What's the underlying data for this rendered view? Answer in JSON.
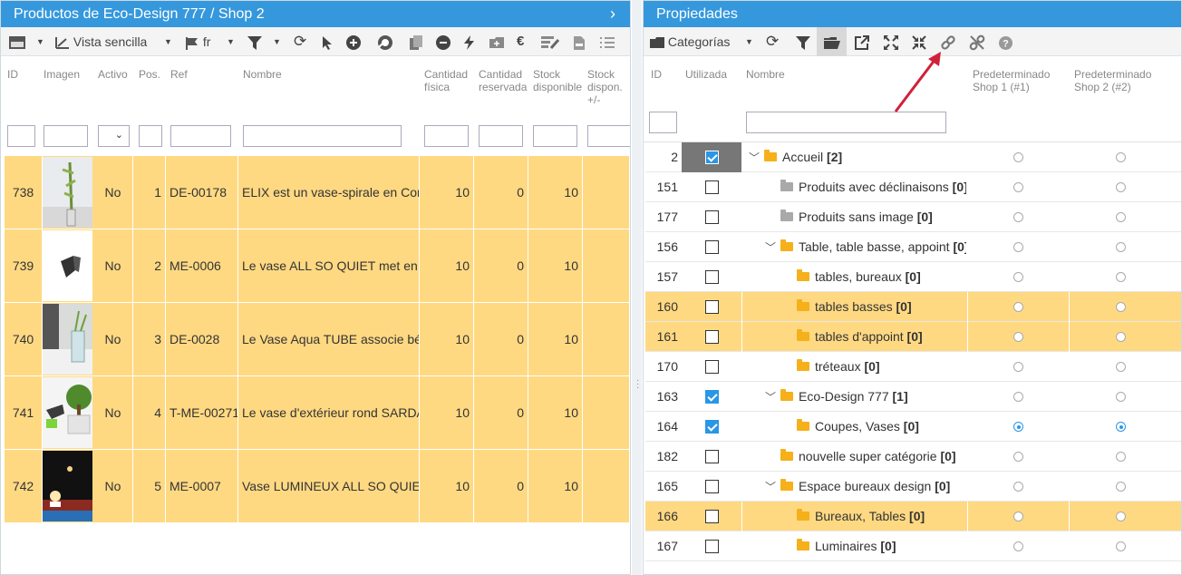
{
  "left_panel": {
    "title": "Productos de Eco-Design 777 / Shop 2",
    "toolbar": {
      "view_label": "Vista sencilla",
      "lang_label": "fr"
    },
    "columns": [
      "ID",
      "Imagen",
      "Activo",
      "Pos.",
      "Ref",
      "Nombre",
      "Cantidad\nfísica",
      "Cantidad\nreservada",
      "Stock\ndisponible",
      "Stock\ndispon.\n+/-"
    ],
    "rows": [
      {
        "id": "738",
        "active": "No",
        "pos": "1",
        "ref": "DE-00178",
        "name": "ELIX est un vase-spirale en Cor",
        "qty": "10",
        "reserved": "0",
        "stock": "10"
      },
      {
        "id": "739",
        "active": "No",
        "pos": "2",
        "ref": "ME-0006",
        "name": "Le vase ALL SO QUIET met en",
        "qty": "10",
        "reserved": "0",
        "stock": "10"
      },
      {
        "id": "740",
        "active": "No",
        "pos": "3",
        "ref": "DE-0028",
        "name": "Le Vase Aqua TUBE associe bé",
        "qty": "10",
        "reserved": "0",
        "stock": "10"
      },
      {
        "id": "741",
        "active": "No",
        "pos": "4",
        "ref": "T-ME-00271",
        "name": "Le vase d'extérieur rond SARDA",
        "qty": "10",
        "reserved": "0",
        "stock": "10"
      },
      {
        "id": "742",
        "active": "No",
        "pos": "5",
        "ref": "ME-0007",
        "name": "Vase LUMINEUX ALL SO QUIE",
        "qty": "10",
        "reserved": "0",
        "stock": "10"
      }
    ]
  },
  "right_panel": {
    "title": "Propiedades",
    "toolbar": {
      "categories_label": "Categorías"
    },
    "columns": [
      "ID",
      "Utilizada",
      "Nombre",
      "Predeterminado\nShop 1 (#1)",
      "Predeterminado\nShop 2 (#2)"
    ],
    "rows": [
      {
        "id": "2",
        "checked": true,
        "level": 0,
        "expander": "expanded",
        "folder": "yellow",
        "name": "Accueil",
        "count": "[2]",
        "highlight": false,
        "selected": true,
        "s1": false,
        "s2": false
      },
      {
        "id": "151",
        "checked": false,
        "level": 1,
        "expander": "none",
        "folder": "grey",
        "name": "Produits avec déclinaisons",
        "count": "[0]",
        "highlight": false,
        "s1": false,
        "s2": false
      },
      {
        "id": "177",
        "checked": false,
        "level": 1,
        "expander": "none",
        "folder": "grey",
        "name": "Produits sans image",
        "count": "[0]",
        "highlight": false,
        "s1": false,
        "s2": false
      },
      {
        "id": "156",
        "checked": false,
        "level": 1,
        "expander": "expanded",
        "folder": "yellow",
        "name": "Table, table basse, appoint",
        "count": "[0]",
        "highlight": false,
        "s1": false,
        "s2": false
      },
      {
        "id": "157",
        "checked": false,
        "level": 2,
        "expander": "none",
        "folder": "yellow",
        "name": "tables, bureaux",
        "count": "[0]",
        "highlight": false,
        "s1": false,
        "s2": false
      },
      {
        "id": "160",
        "checked": false,
        "level": 2,
        "expander": "none",
        "folder": "yellow",
        "name": "tables basses",
        "count": "[0]",
        "highlight": true,
        "s1": false,
        "s2": false
      },
      {
        "id": "161",
        "checked": false,
        "level": 2,
        "expander": "none",
        "folder": "yellow",
        "name": "tables d'appoint",
        "count": "[0]",
        "highlight": true,
        "s1": false,
        "s2": false
      },
      {
        "id": "170",
        "checked": false,
        "level": 2,
        "expander": "none",
        "folder": "yellow",
        "name": "tréteaux",
        "count": "[0]",
        "highlight": false,
        "s1": false,
        "s2": false
      },
      {
        "id": "163",
        "checked": true,
        "level": 1,
        "expander": "expanded",
        "folder": "yellow",
        "name": "Eco-Design 777",
        "count": "[1]",
        "highlight": false,
        "s1": false,
        "s2": false
      },
      {
        "id": "164",
        "checked": true,
        "level": 2,
        "expander": "none",
        "folder": "yellow",
        "name": "Coupes, Vases",
        "count": "[0]",
        "highlight": false,
        "s1": true,
        "s2": true
      },
      {
        "id": "182",
        "checked": false,
        "level": 1,
        "expander": "none",
        "folder": "yellow",
        "name": "nouvelle super catégorie",
        "count": "[0]",
        "highlight": false,
        "s1": false,
        "s2": false
      },
      {
        "id": "165",
        "checked": false,
        "level": 1,
        "expander": "expanded",
        "folder": "yellow",
        "name": "Espace bureaux design",
        "count": "[0]",
        "highlight": false,
        "s1": false,
        "s2": false
      },
      {
        "id": "166",
        "checked": false,
        "level": 2,
        "expander": "none",
        "folder": "yellow",
        "name": "Bureaux, Tables",
        "count": "[0]",
        "highlight": true,
        "s1": false,
        "s2": false
      },
      {
        "id": "167",
        "checked": false,
        "level": 2,
        "expander": "none",
        "folder": "yellow",
        "name": "Luminaires",
        "count": "[0]",
        "highlight": false,
        "s1": false,
        "s2": false
      }
    ]
  },
  "colors": {
    "accent": "#3598dc",
    "row_highlight": "#ffd982",
    "checkbox": "#2a96e6",
    "annotation_arrow": "#d0213a"
  }
}
